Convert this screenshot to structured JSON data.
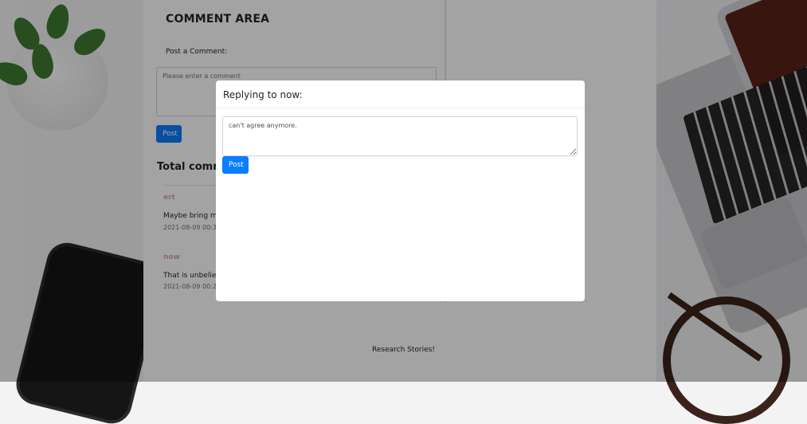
{
  "comment_area": {
    "title": "COMMENT AREA",
    "post_label": "Post a Comment:",
    "textarea_placeholder": "Please enter a comment",
    "post_button": "Post"
  },
  "comments": {
    "heading": "Total comm",
    "items": [
      {
        "author": "ert",
        "text": "Maybe bring mo",
        "time": "2021-08-09 00:3"
      },
      {
        "author": "now",
        "text": "That is unbelieva",
        "time": "2021-08-09 00:2"
      }
    ]
  },
  "footer": {
    "text": "Research Stories!"
  },
  "modal": {
    "title": "Replying to now:",
    "reply_value": "can't agree anymore.",
    "post_button": "Post"
  },
  "colors": {
    "primary": "#0d7bfd",
    "author": "#e8a1a7",
    "backdrop": "rgba(0,0,0,0.36)"
  }
}
